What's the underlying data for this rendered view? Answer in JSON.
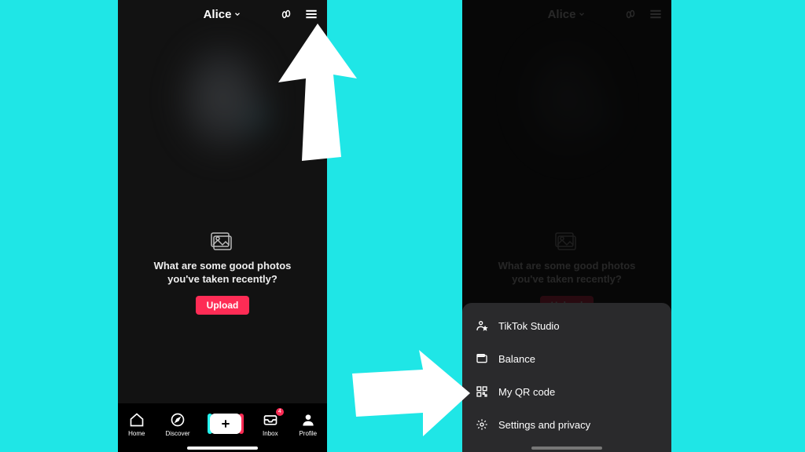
{
  "username": "Alice",
  "prompt": {
    "line1": "What are some good photos",
    "line2": "you've taken recently?",
    "upload_label": "Upload"
  },
  "nav": {
    "home": "Home",
    "discover": "Discover",
    "inbox": "Inbox",
    "inbox_badge": "4",
    "profile": "Profile"
  },
  "sheet": {
    "items": [
      {
        "label": "TikTok Studio"
      },
      {
        "label": "Balance"
      },
      {
        "label": "My QR code"
      },
      {
        "label": "Settings and privacy"
      }
    ]
  }
}
